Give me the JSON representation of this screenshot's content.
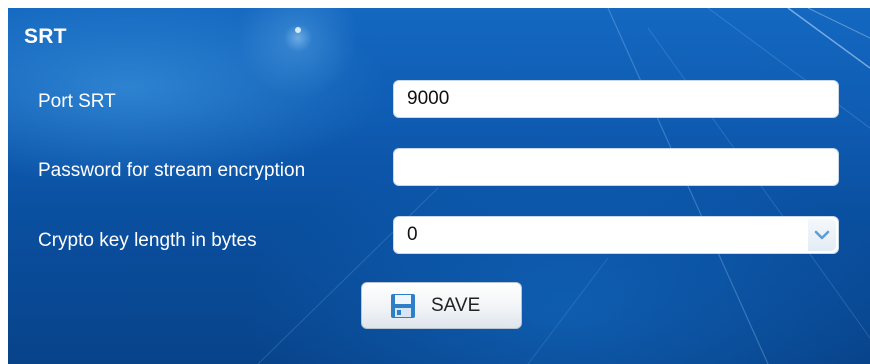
{
  "panel": {
    "title": "SRT"
  },
  "form": {
    "port": {
      "label": "Port SRT",
      "value": "9000"
    },
    "password": {
      "label": "Password for stream encryption",
      "value": ""
    },
    "crypto_key_length": {
      "label": "Crypto key length in bytes",
      "selected": "0"
    }
  },
  "actions": {
    "save_label": "SAVE"
  },
  "icons": {
    "save": "floppy-disk-icon",
    "dropdown": "chevron-down-icon"
  },
  "colors": {
    "panel_background": "#0f5cb3",
    "label_text": "#ffffff",
    "chevron": "#5e9fd6",
    "save_icon": "#2f7fc8"
  }
}
